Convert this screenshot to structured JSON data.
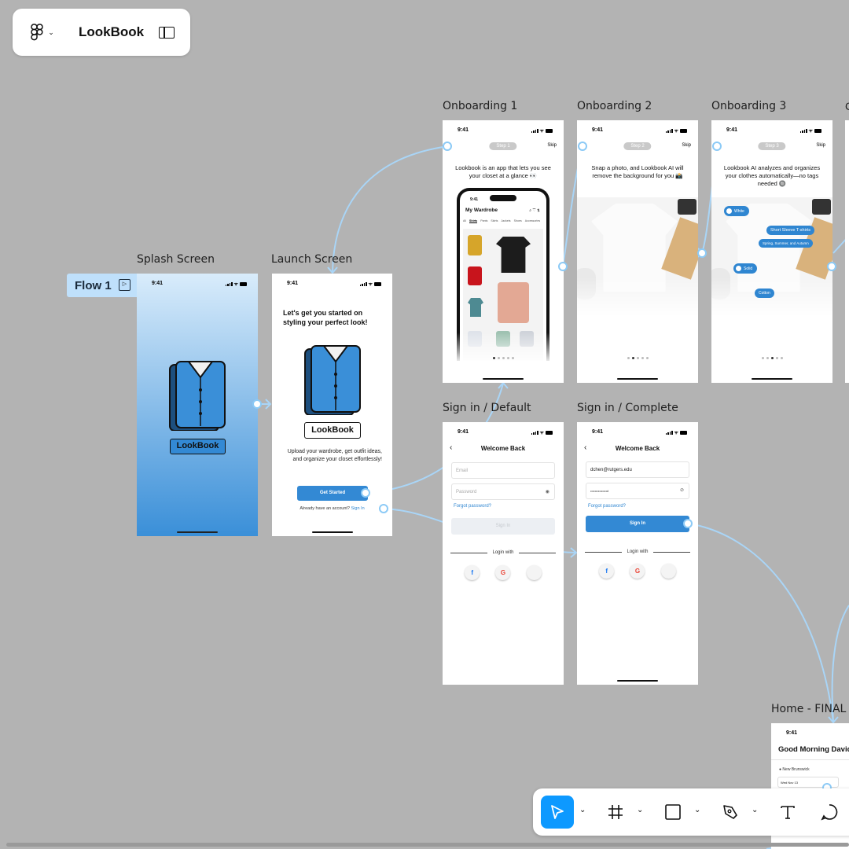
{
  "app": {
    "file_name": "LookBook"
  },
  "flow": {
    "label": "Flow 1"
  },
  "frames": {
    "splash": {
      "label": "Splash Screen",
      "time": "9:41",
      "logo_text": "LookBook"
    },
    "launch": {
      "label": "Launch Screen",
      "time": "9:41",
      "headline": "Let's get you started on styling your perfect look!",
      "logo_text": "LookBook",
      "body": "Upload your wardrobe, get outfit ideas, and organize your closet effortlessly!",
      "cta": "Get Started",
      "signin_prompt": "Already have an account?",
      "signin_link": "Sign In"
    },
    "onb1": {
      "label": "Onboarding 1",
      "time": "9:41",
      "step": "Step 1",
      "skip": "Skip",
      "text": "Lookbook is an app that lets you see your closet at a glance 👀",
      "phone_time": "9:41",
      "phone_title": "My Wardrobe",
      "phone_tabs": [
        "All",
        "Shirts",
        "Pants",
        "Skirts",
        "Jackets",
        "Shoes",
        "Accessories"
      ]
    },
    "onb2": {
      "label": "Onboarding 2",
      "time": "9:41",
      "step": "Step 2",
      "skip": "Skip",
      "text": "Snap a photo, and Lookbook AI will remove the background for you 📸"
    },
    "onb3": {
      "label": "Onboarding 3",
      "time": "9:41",
      "step": "Step 3",
      "skip": "Skip",
      "text": "Lookbook AI analyzes and organizes your clothes automatically—no tags needed 🔘",
      "tags": [
        "White",
        "Short Sleeve T-shirts",
        "Spring, Summer, and Autumn",
        "Solid",
        "Cotton"
      ]
    },
    "signin_default": {
      "label": "Sign in / Default",
      "time": "9:41",
      "title": "Welcome Back",
      "email_placeholder": "Email",
      "password_placeholder": "Password",
      "forgot": "Forgot password?",
      "button": "Sign In",
      "login_with": "Login with"
    },
    "signin_complete": {
      "label": "Sign in / Complete",
      "time": "9:41",
      "title": "Welcome Back",
      "email_value": "dchen@rutgers.edu",
      "password_value": "••••••••••••••••l",
      "forgot": "Forgot password?",
      "button": "Sign In",
      "login_with": "Login with"
    },
    "home": {
      "label": "Home - FINAL",
      "time": "9:41",
      "greeting": "Good Morning David",
      "location": "New Brunswick",
      "weather": "Wed Nov 13"
    }
  },
  "social_icons": [
    "facebook-icon",
    "google-icon",
    "apple-icon"
  ],
  "colors": {
    "canvas": "#b3b3b3",
    "accent": "#3389d4",
    "connector": "#a9d5f7",
    "toolbar_active": "#0d99ff"
  },
  "toolbar": {
    "tools": [
      "move-tool",
      "frame-tool",
      "shape-tool",
      "pen-tool",
      "text-tool",
      "comment-tool"
    ]
  }
}
